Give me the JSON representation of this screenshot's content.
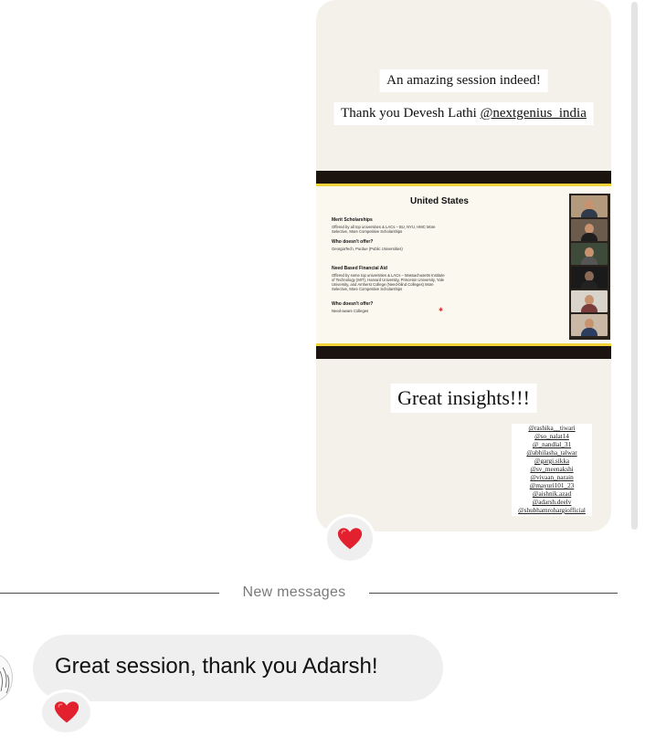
{
  "story": {
    "caption_line1": "An amazing session indeed!",
    "caption_line2_prefix": "Thank you Devesh Lathi ",
    "caption_line2_handle": "@nextgenius_india",
    "insights": "Great insights!!!",
    "slide": {
      "title": "United States",
      "merit_heading": "Merit Scholarships",
      "merit_body": "Offered by all top universities & LACs – BU, NYU, HMC More Selective, More Competitive Scholarships",
      "merit_who_heading": "Who doesn't offer?",
      "merit_who_body": "GeorgiaTech, Purdue (Public Universities)",
      "need_heading": "Need Based Financial Aid",
      "need_body": "Offered by some top universities & LACs – Massachusetts Institute of Technology (MIT), Harvard University, Princeton University, Yale University, and Amherst College (Need-blind Colleges) More Selective, More Competitive Scholarships",
      "need_who_heading": "Who doesn't offer?",
      "need_who_body": "Need-aware Colleges"
    },
    "mentions": [
      "@rashika__tiwari",
      "@so_nalat14",
      "@_nandlal_31",
      "@abhilasha_talwar",
      "@gargi.sikka",
      "@sv_meenakshi",
      "@vivaan_narain",
      "@mayuri101_23",
      "@aishnik.azad",
      "@adarsh.deelv",
      "@shubhamrohargiofficial"
    ]
  },
  "divider": {
    "label": "New messages"
  },
  "message": {
    "text": "Great session, thank you Adarsh!"
  },
  "reactions": {
    "story": "❤️",
    "message": "❤️"
  },
  "colors": {
    "bubble": "#efefef",
    "heart": "#e2202e",
    "slide_accent": "#f2d33a",
    "story_bg": "#f4f1ea"
  },
  "icons": {
    "reaction": "red-heart-icon",
    "avatar": "avatar-illustration"
  }
}
